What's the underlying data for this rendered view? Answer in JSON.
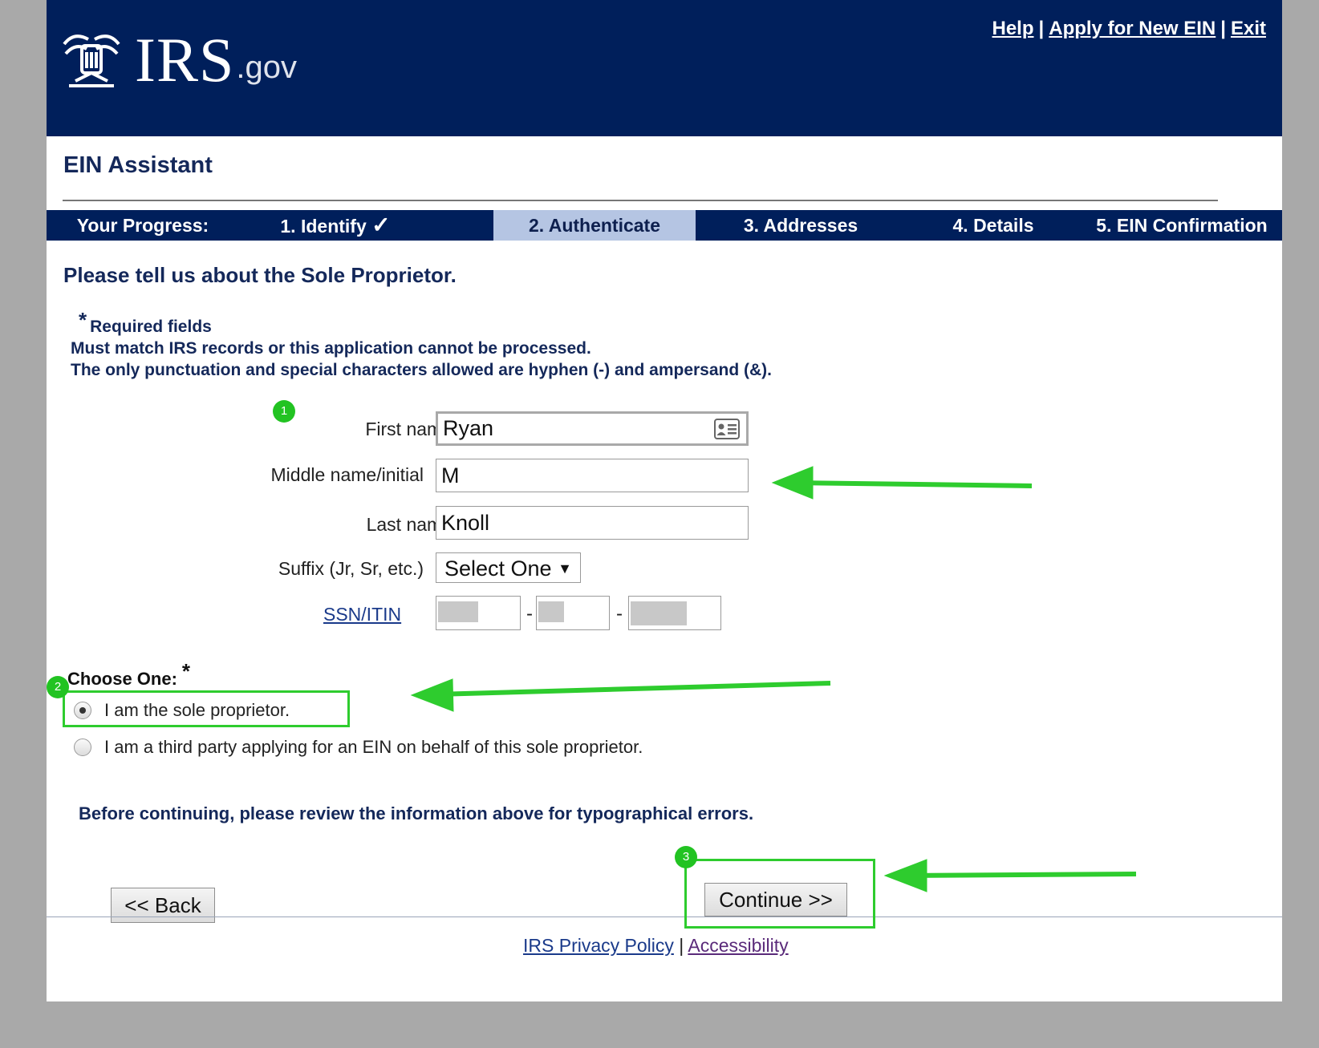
{
  "header": {
    "logo_irs": "IRS",
    "logo_gov": ".gov",
    "links": [
      "Help",
      "Apply for New EIN",
      "Exit"
    ],
    "separator": "|"
  },
  "assistant_title": "EIN Assistant",
  "progress": {
    "label": "Your Progress:",
    "steps": [
      "1. Identify",
      "2. Authenticate",
      "3. Addresses",
      "4. Details",
      "5. EIN Confirmation"
    ],
    "completed_mark": "✓",
    "active_step": "2. Authenticate"
  },
  "heading": "Please tell us about the Sole Proprietor.",
  "notes": {
    "required_star": "*",
    "required": "Required fields",
    "line1": "Must match IRS records or this application cannot be processed.",
    "line2": "The only punctuation and special characters allowed are hyphen (-) and ampersand (&)."
  },
  "form": {
    "first_name_label": "First name",
    "first_name_value": "Ryan",
    "middle_label": "Middle name/initial",
    "middle_value": "M",
    "last_name_label": "Last name",
    "last_name_value": "Knoll",
    "suffix_label": "Suffix (Jr, Sr, etc.)",
    "suffix_value": "Select One",
    "ssn_label": "SSN/ITIN",
    "required_star": "*",
    "dash": "-"
  },
  "choose": {
    "label": "Choose One:",
    "star": "*",
    "options": [
      "I am the sole proprietor.",
      "I am a third party applying for an EIN on behalf of this sole proprietor."
    ],
    "selected_index": 0
  },
  "review_text": "Before continuing, please review the information above for typographical errors.",
  "buttons": {
    "back": "<< Back",
    "continue": "Continue >>"
  },
  "footer": {
    "privacy": "IRS Privacy Policy",
    "separator": "|",
    "accessibility": "Accessibility"
  },
  "annotations": {
    "badges": [
      "1",
      "2",
      "3"
    ],
    "color": "#2ecc2e"
  },
  "colors": {
    "navy": "#001f5b",
    "active_step_bg": "#b5c5e3",
    "text_navy": "#14285a"
  }
}
